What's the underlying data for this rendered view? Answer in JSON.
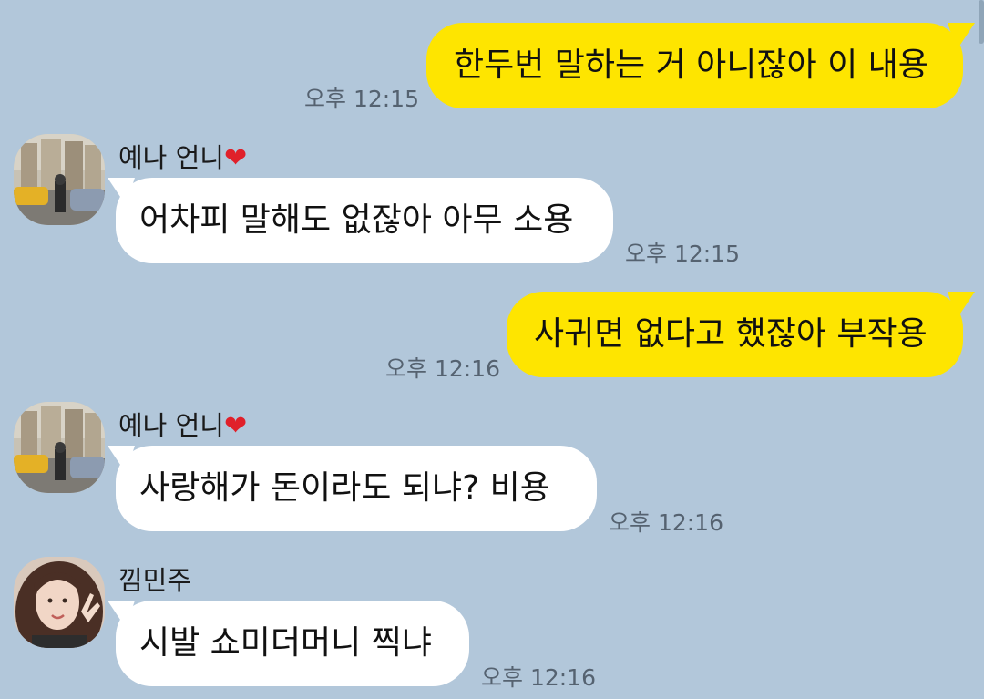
{
  "messages": [
    {
      "direction": "out",
      "text": "한두번 말하는 거 아니잖아 이 내용",
      "time": "오후 12:15"
    },
    {
      "direction": "in",
      "sender": "예나 언니",
      "sender_emoji": "❤",
      "text": "어차피 말해도 없잖아 아무 소용",
      "time": "오후 12:15"
    },
    {
      "direction": "out",
      "text": "사귀면 없다고 했잖아 부작용",
      "time": "오후 12:16"
    },
    {
      "direction": "in",
      "sender": "예나 언니",
      "sender_emoji": "❤",
      "text": "사랑해가 돈이라도 되냐?  비용",
      "time": "오후 12:16"
    },
    {
      "direction": "in",
      "sender": "낌민주",
      "text": "시발 쇼미더머니 찍냐",
      "time": "오후 12:16"
    }
  ],
  "colors": {
    "background": "#b2c7da",
    "outgoing_bubble": "#fee500",
    "incoming_bubble": "#ffffff",
    "heart": "#e0202a"
  }
}
